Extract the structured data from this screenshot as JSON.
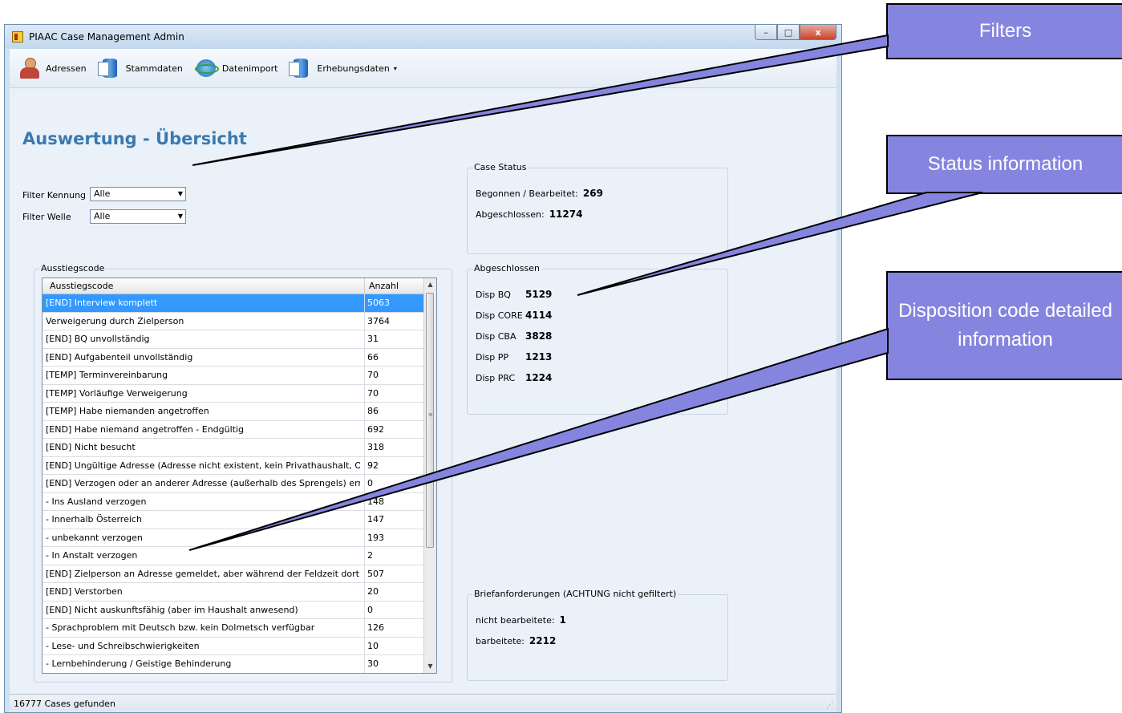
{
  "window": {
    "title": "PIAAC Case Management Admin",
    "buttons": {
      "minimize": "–",
      "maximize": "□",
      "close": "x"
    }
  },
  "toolbar": {
    "items": [
      {
        "label": "Adressen",
        "icon": "person-icon"
      },
      {
        "label": "Stammdaten",
        "icon": "database-icon"
      },
      {
        "label": "Datenimport",
        "icon": "import-icon"
      },
      {
        "label": "Erhebungsdaten",
        "icon": "database-icon",
        "dropdown": "▾"
      }
    ]
  },
  "page": {
    "title": "Auswertung - Übersicht"
  },
  "filters": {
    "kennung": {
      "label": "Filter Kennung",
      "value": "Alle"
    },
    "welle": {
      "label": "Filter Welle",
      "value": "Alle"
    }
  },
  "case_status": {
    "title": "Case Status",
    "begonnen_label": "Begonnen / Bearbeitet:",
    "begonnen_value": "269",
    "abgeschlossen_label": "Abgeschlossen:",
    "abgeschlossen_value": "11274"
  },
  "abgeschlossen": {
    "title": "Abgeschlossen",
    "rows": [
      {
        "label": "Disp BQ",
        "value": "5129"
      },
      {
        "label": "Disp CORE",
        "value": "4114"
      },
      {
        "label": "Disp CBA",
        "value": "3828"
      },
      {
        "label": "Disp PP",
        "value": "1213"
      },
      {
        "label": "Disp PRC",
        "value": "1224"
      }
    ]
  },
  "ausstieg": {
    "title": "Ausstiegscode",
    "columns": [
      "Ausstiegscode",
      "Anzahl"
    ],
    "rows": [
      {
        "code": "[END] Interview komplett",
        "count": "5063",
        "selected": true
      },
      {
        "code": "Verweigerung durch Zielperson",
        "count": "3764"
      },
      {
        "code": "[END] BQ unvollständig",
        "count": "31"
      },
      {
        "code": "[END] Aufgabenteil unvollständig",
        "count": "66"
      },
      {
        "code": "[TEMP] Terminvereinbarung",
        "count": "70"
      },
      {
        "code": "[TEMP] Vorläufige Verweigerung",
        "count": "70"
      },
      {
        "code": "[TEMP] Habe niemanden angetroffen",
        "count": "86"
      },
      {
        "code": "[END] Habe niemand angetroffen - Endgültig",
        "count": "692"
      },
      {
        "code": "[END] Nicht besucht",
        "count": "318"
      },
      {
        "code": "[END] Ungültige Adresse (Adresse nicht existent, kein Privathaushalt, O...",
        "count": "92"
      },
      {
        "code": "[END] Verzogen oder an anderer Adresse (außerhalb des Sprengels) err...",
        "count": "0"
      },
      {
        "code": "- Ins Ausland verzogen",
        "count": "148"
      },
      {
        "code": "- Innerhalb Österreich",
        "count": "147"
      },
      {
        "code": "- unbekannt verzogen",
        "count": "193"
      },
      {
        "code": "- In Anstalt verzogen",
        "count": "2"
      },
      {
        "code": "[END] Zielperson an Adresse gemeldet, aber während der Feldzeit dort...",
        "count": "507"
      },
      {
        "code": "[END] Verstorben",
        "count": "20"
      },
      {
        "code": "[END] Nicht auskunftsfähig (aber im Haushalt anwesend)",
        "count": "0"
      },
      {
        "code": "- Sprachproblem mit Deutsch bzw. kein Dolmetsch verfügbar",
        "count": "126"
      },
      {
        "code": "- Lese- und Schreibschwierigkeiten",
        "count": "10"
      },
      {
        "code": "- Lernbehinderung / Geistige Behinderung",
        "count": "30"
      }
    ]
  },
  "brief": {
    "title": "Briefanforderungen (ACHTUNG nicht gefiltert)",
    "nicht_label": "nicht bearbeitete:",
    "nicht_value": "1",
    "bearbeitet_label": "barbeitete:",
    "bearbeitet_value": "2212"
  },
  "status_bar": {
    "text": "16777 Cases gefunden"
  },
  "callouts": {
    "filters": "Filters",
    "status": "Status information",
    "disposition": "Disposition code detailed information"
  },
  "colors": {
    "callout": "#8585e0",
    "selection": "#3399ff",
    "title": "#3a7ab0"
  }
}
